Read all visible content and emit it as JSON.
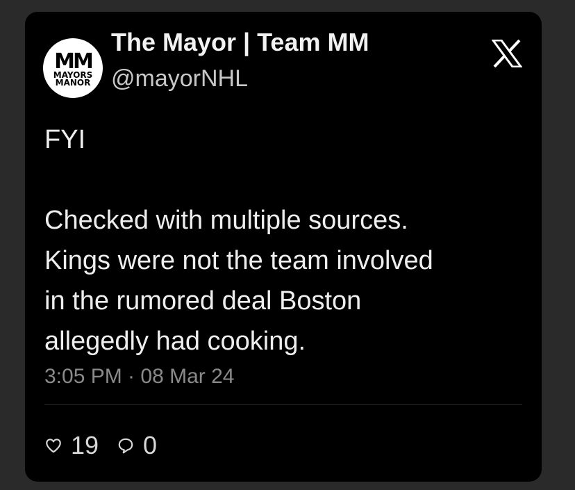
{
  "tweet": {
    "author": {
      "display_name": "The Mayor | Team MM",
      "handle": "@mayorNHL",
      "avatar": {
        "mark": "MM",
        "text_line1": "MAYORS",
        "text_line2": "MANOR"
      }
    },
    "platform_icon": "x-logo-icon",
    "text": {
      "line1": "FYI",
      "body": "Checked with multiple sources.\nKings were not the team involved\nin the rumored deal Boston\nallegedly had cooking."
    },
    "timestamp": "3:05 PM · 08 Mar 24",
    "actions": {
      "likes": {
        "icon": "heart-icon",
        "count": "19"
      },
      "replies": {
        "icon": "reply-bubble-icon",
        "count": "0"
      }
    }
  },
  "colors": {
    "background": "#2a2a2a",
    "card": "#000000",
    "text_primary": "#eeeeee",
    "text_secondary": "#8a8a8a"
  }
}
